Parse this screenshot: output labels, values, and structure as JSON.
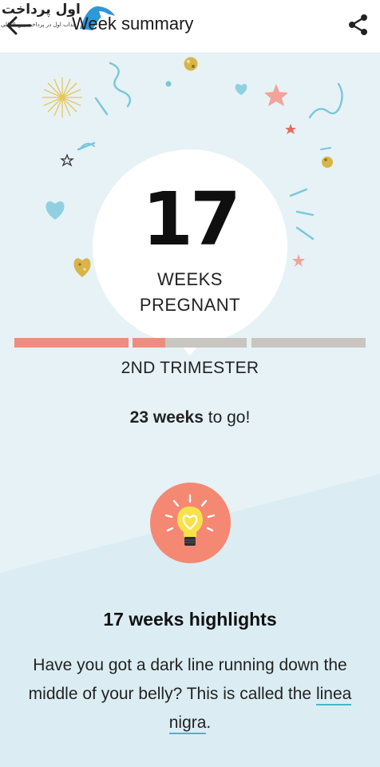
{
  "header": {
    "title": "Week summary",
    "back_icon": "arrow-back-icon",
    "share_icon": "share-icon",
    "watermark": {
      "text": "اول پرداخت",
      "subtitle": "جذاب اول در پرداخت بین المللی"
    }
  },
  "hero": {
    "week_number": "17",
    "weeks_label": "WEEKS",
    "pregnant_label": "PREGNANT"
  },
  "progress": {
    "segments": [
      {
        "fill": 1.0
      },
      {
        "fill": 0.29
      },
      {
        "fill": 0.0
      }
    ],
    "trimester_label": "2ND TRIMESTER",
    "weeks_to_go_bold": "23 weeks",
    "weeks_to_go_rest": " to go!"
  },
  "highlights": {
    "icon": "lightbulb-heart-icon",
    "title": "17 weeks highlights",
    "body_prefix": "Have you got a dark line running down the middle of your belly? This is called the ",
    "link_text": "linea nigra",
    "body_suffix": "."
  },
  "colors": {
    "accent": "#eb8e7e",
    "track": "#c9c5c1",
    "background": "#e6f2f6",
    "link_underline": "#49b5cc",
    "bulb_circle": "#f58873"
  }
}
